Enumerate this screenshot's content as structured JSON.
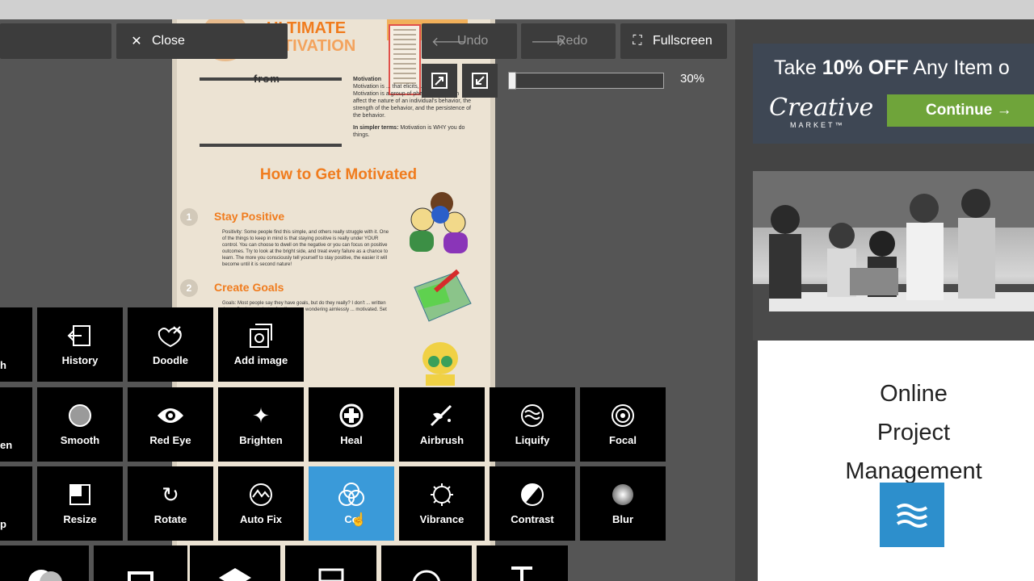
{
  "toolbar": {
    "close_label": "Close",
    "undo_label": "Undo",
    "redo_label": "Redo",
    "fullscreen_label": "Fullscreen",
    "zoom_level": "30%",
    "zoom_fraction": 0.0
  },
  "document": {
    "title_line1": "ULTIMATE",
    "title_line2": "MOTIVATION",
    "from_label": "from",
    "definition_head": "Motivation",
    "definition_text": "Motivation is ... that elicits, ... behaviors. Motivation is a group of phenomena which affect the nature of an individual's behavior, the strength of the behavior, and the persistence of the behavior.",
    "simpler_label": "In simpler terms:",
    "simpler_text": "Motivation is WHY you do things.",
    "heading": "How to Get Motivated",
    "section1": "Stay Positive",
    "section1_num": "1",
    "section1_text": "Positivity: Some people find this simple, and others really struggle with it. One of the things to keep in mind is that staying positive is really under YOUR control. You can choose to dwell on the negative or you can focus on positive outcomes. Try to look at the bright side, and treat every failure as a chance to learn. The more you consciously tell yourself to stay positive, the easier it will become until it is second nature!",
    "section2": "Create Goals",
    "section2_num": "2",
    "section2_text": "Goals: Most people say they have goals, but do they really? I don't ... written down. Goals are what ... for. If you are wondering aimlessly ... motivated. Set some goals, and you"
  },
  "tools": {
    "row1": [
      {
        "label": "h",
        "icon": "partial-icon"
      },
      {
        "label": "History",
        "icon": "history-icon"
      },
      {
        "label": "Doodle",
        "icon": "doodle-icon"
      },
      {
        "label": "Add image",
        "icon": "add-image-icon"
      }
    ],
    "row2": [
      {
        "label": "en",
        "icon": "partial-icon"
      },
      {
        "label": "Smooth",
        "icon": "smooth-icon"
      },
      {
        "label": "Red Eye",
        "icon": "red-eye-icon"
      },
      {
        "label": "Brighten",
        "icon": "brighten-icon"
      },
      {
        "label": "Heal",
        "icon": "heal-icon"
      },
      {
        "label": "Airbrush",
        "icon": "airbrush-icon"
      },
      {
        "label": "Liquify",
        "icon": "liquify-icon"
      },
      {
        "label": "Focal",
        "icon": "focal-icon"
      }
    ],
    "row3": [
      {
        "label": "p",
        "icon": "partial-icon"
      },
      {
        "label": "Resize",
        "icon": "resize-icon"
      },
      {
        "label": "Rotate",
        "icon": "rotate-icon"
      },
      {
        "label": "Auto Fix",
        "icon": "auto-fix-icon"
      },
      {
        "label": "Co",
        "icon": "color-icon"
      },
      {
        "label": "Vibrance",
        "icon": "vibrance-icon"
      },
      {
        "label": "Contrast",
        "icon": "contrast-icon"
      },
      {
        "label": "Blur",
        "icon": "blur-icon"
      }
    ]
  },
  "ad": {
    "promo_prefix": "Take ",
    "promo_bold": "10% OFF",
    "promo_suffix": " Any Item o",
    "brand": "Creative",
    "brand_sub": "MARKET™",
    "cta": "Continue →",
    "card_title_1": "Online",
    "card_title_2": "Project",
    "card_title_3": "Management"
  },
  "colors": {
    "active_tool": "#3a9ad9",
    "accent_orange": "#f07c1e",
    "cta_green": "#6fa43a",
    "logo_blue": "#2d8fcc"
  }
}
